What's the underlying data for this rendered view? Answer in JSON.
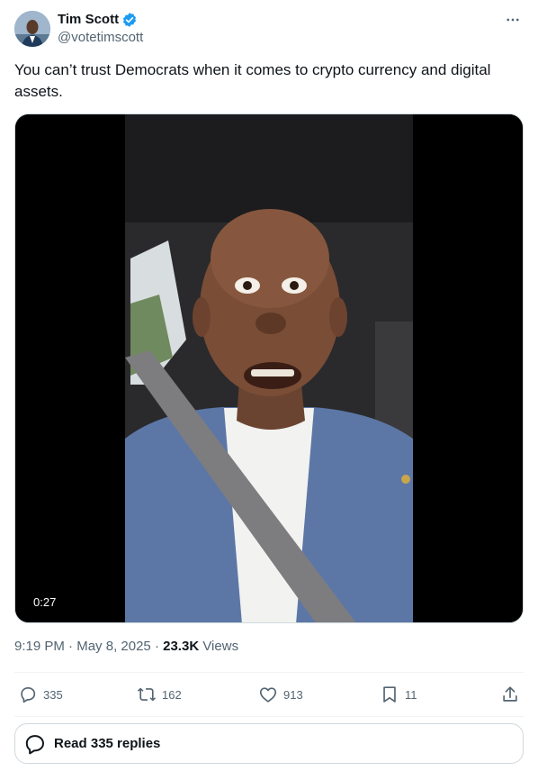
{
  "author": {
    "display_name": "Tim Scott",
    "handle": "@votetimscott",
    "verified": true
  },
  "tweet": {
    "text": "You can’t trust Democrats when it comes to crypto currency and digital assets.",
    "video_duration": "0:27",
    "time": "9:19 PM",
    "date": "May 8, 2025",
    "separator": "·",
    "views_count": "23.3K",
    "views_label": "Views"
  },
  "actions": {
    "replies": "335",
    "reposts": "162",
    "likes": "913",
    "bookmarks": "11"
  },
  "read_replies_label": "Read 335 replies",
  "colors": {
    "text_primary": "#0f1419",
    "text_secondary": "#536471",
    "verified_blue": "#1d9bf0",
    "border": "#cfd9de",
    "divider": "#eff3f4"
  },
  "icons": [
    "verified-badge-icon",
    "more-icon",
    "reply-icon",
    "repost-icon",
    "like-icon",
    "bookmark-icon",
    "share-icon",
    "read-replies-icon"
  ]
}
